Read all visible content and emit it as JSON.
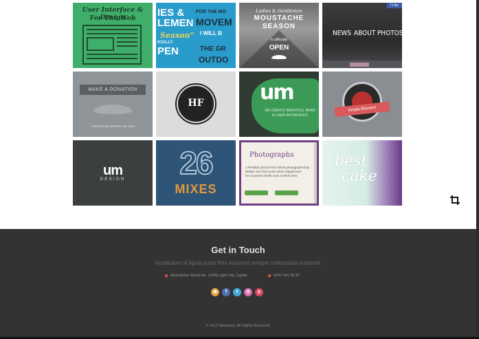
{
  "portfolio": {
    "t1": {
      "line1": "User Interface & Design",
      "line2": "For The Web"
    },
    "t2": {
      "b1": "IES &",
      "b2": "LEMEN",
      "s1": "Season\"",
      "s2": "ICIALLY",
      "b3": "PEN",
      "r1": "FOR THE MO",
      "r2": "MOVEM",
      "r3": "I WILL B",
      "r4": "THE GR",
      "r5": "OUTDO"
    },
    "t3": {
      "a": "Ladies & Gentlemen",
      "b": "MOUSTACHE",
      "c": "SEASON",
      "d": "is officially",
      "e": "OPEN"
    },
    "t4": {
      "fb": "f Like",
      "nav1": "NEWS",
      "nav2": "ABOUT",
      "nav3": "PHOTOS"
    },
    "t5": {
      "donate": "MAKE A DONATION",
      "caption": "\"...because lip sweaters are sexy.\""
    },
    "t6": {
      "badge": "HF"
    },
    "t7": {
      "mark": "um",
      "c1": "WE CREATE WEBSITES, BRAN",
      "c2": "& USER INTERFACES"
    },
    "t8": {
      "ribbon": "Ample Element"
    },
    "t9": {
      "mark": "um",
      "word": "DESIGN"
    },
    "t10": {
      "num": "26",
      "mixes": "MIXES"
    },
    "t11": {
      "title": "Photographs",
      "x1": "A Reliable picture from below photographed by",
      "x2": "Walker see how works when fatgold here",
      "x3": "for a tunners kindle ones at them here",
      "btn1": "",
      "btn2": ""
    },
    "t12": {
      "line1": "best",
      "line2": "cake"
    }
  },
  "footer": {
    "title": "Get in Touch",
    "subtitle": "Vestibulum id ligula porta felis euismod semper malesuada euismod.",
    "address": "Moonshine Street No. 14/05 Light City, Jupiter",
    "phone": "0247 541 65 87",
    "copyright": "© 2013 Webpaint. All Rights Reserved."
  },
  "social": [
    {
      "icon": "rss-icon",
      "glyph": "◉"
    },
    {
      "icon": "facebook-icon",
      "glyph": "f"
    },
    {
      "icon": "twitter-icon",
      "glyph": "t"
    },
    {
      "icon": "dribbble-icon",
      "glyph": "◎"
    },
    {
      "icon": "pinterest-icon",
      "glyph": "p"
    }
  ],
  "colors": {
    "footer_bg": "#333333",
    "footer_title": "#e2e2e2",
    "accent_red": "#d9534f"
  }
}
